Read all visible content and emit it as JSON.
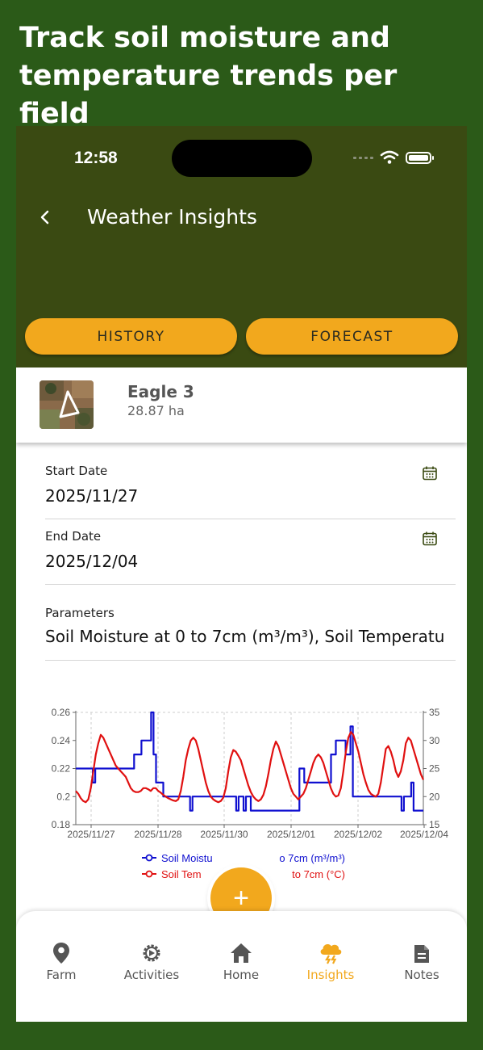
{
  "promo": {
    "line1": "Track soil moisture and",
    "line2": "temperature trends per field"
  },
  "status_bar": {
    "time": "12:58"
  },
  "header": {
    "title": "Weather Insights"
  },
  "tabs": {
    "history": "HISTORY",
    "forecast": "FORECAST"
  },
  "field": {
    "name": "Eagle 3",
    "area": "28.87 ha"
  },
  "form": {
    "start_date": {
      "label": "Start Date",
      "value": "2025/11/27"
    },
    "end_date": {
      "label": "End Date",
      "value": "2025/12/04"
    },
    "parameters": {
      "label": "Parameters",
      "value": "Soil Moisture at 0 to 7cm (m³/m³), Soil Temperatu"
    }
  },
  "chart_data": {
    "type": "line",
    "x_tick_labels": [
      "2025/11/27",
      "2025/11/28",
      "2025/11/30",
      "2025/12/01",
      "2025/12/02",
      "2025/12/04"
    ],
    "y_left_ticks": [
      "0.26",
      "0.24",
      "0.22",
      "0.2",
      "0.18"
    ],
    "y_right_ticks": [
      "35",
      "30",
      "25",
      "20",
      "15"
    ],
    "ylim_left": [
      0.18,
      0.26
    ],
    "ylim_right": [
      15,
      35
    ],
    "grid": "dashed-vertical",
    "legend_position": "bottom",
    "series": [
      {
        "name": "Soil Moisture at 0 to 7cm (m³/m³)",
        "legend_visible": "Soil Moistu",
        "legend_visible_tail": "o 7cm (m³/m³)",
        "axis": "left",
        "color": "#1010d0",
        "values": [
          0.22,
          0.22,
          0.22,
          0.22,
          0.22,
          0.22,
          0.22,
          0.21,
          0.22,
          0.22,
          0.22,
          0.22,
          0.22,
          0.22,
          0.22,
          0.22,
          0.22,
          0.22,
          0.22,
          0.22,
          0.22,
          0.22,
          0.22,
          0.22,
          0.23,
          0.23,
          0.23,
          0.24,
          0.24,
          0.24,
          0.24,
          0.26,
          0.23,
          0.21,
          0.21,
          0.21,
          0.2,
          0.2,
          0.2,
          0.2,
          0.2,
          0.2,
          0.2,
          0.2,
          0.2,
          0.2,
          0.2,
          0.19,
          0.2,
          0.2,
          0.2,
          0.2,
          0.2,
          0.2,
          0.2,
          0.2,
          0.2,
          0.2,
          0.2,
          0.2,
          0.2,
          0.2,
          0.2,
          0.2,
          0.2,
          0.2,
          0.19,
          0.2,
          0.2,
          0.19,
          0.2,
          0.2,
          0.19,
          0.19,
          0.19,
          0.19,
          0.19,
          0.19,
          0.19,
          0.19,
          0.19,
          0.19,
          0.19,
          0.19,
          0.19,
          0.19,
          0.19,
          0.19,
          0.19,
          0.19,
          0.19,
          0.19,
          0.22,
          0.22,
          0.21,
          0.21,
          0.21,
          0.21,
          0.21,
          0.21,
          0.21,
          0.21,
          0.21,
          0.21,
          0.21,
          0.23,
          0.23,
          0.24,
          0.24,
          0.24,
          0.24,
          0.23,
          0.23,
          0.25,
          0.2,
          0.2,
          0.2,
          0.2,
          0.2,
          0.2,
          0.2,
          0.2,
          0.2,
          0.2,
          0.2,
          0.2,
          0.2,
          0.2,
          0.2,
          0.2,
          0.2,
          0.2,
          0.2,
          0.2,
          0.19,
          0.2,
          0.2,
          0.2,
          0.21,
          0.19,
          0.19,
          0.19,
          0.19,
          0.19
        ]
      },
      {
        "name": "Soil Temperature at 0 to 7cm (°C)",
        "legend_visible": "Soil Tem",
        "legend_visible_tail": "to 7cm (°C)",
        "axis": "right",
        "color": "#e01010",
        "values": [
          21.0,
          20.5,
          19.7,
          19.2,
          19.0,
          19.5,
          21.5,
          24.5,
          27.5,
          29.5,
          31.0,
          30.5,
          29.5,
          28.5,
          27.5,
          26.5,
          25.5,
          25.0,
          24.5,
          24.0,
          23.5,
          22.5,
          21.5,
          21.0,
          20.8,
          20.8,
          21.0,
          21.5,
          21.5,
          21.3,
          21.0,
          21.5,
          21.5,
          21.0,
          20.7,
          20.3,
          20.0,
          19.7,
          19.5,
          19.3,
          19.2,
          19.5,
          21.0,
          23.5,
          26.5,
          28.5,
          30.0,
          30.5,
          30.0,
          28.5,
          26.5,
          24.5,
          22.5,
          21.0,
          20.0,
          19.5,
          19.2,
          19.0,
          19.2,
          19.8,
          21.5,
          24.5,
          27.0,
          28.3,
          28.0,
          27.3,
          26.5,
          25.0,
          23.5,
          22.0,
          20.8,
          20.0,
          19.5,
          19.2,
          19.5,
          20.3,
          21.8,
          24.0,
          26.5,
          28.5,
          29.8,
          29.0,
          27.5,
          26.0,
          24.5,
          23.0,
          21.5,
          20.5,
          20.0,
          19.5,
          20.0,
          20.5,
          21.5,
          23.0,
          24.5,
          26.0,
          27.0,
          27.5,
          27.0,
          26.0,
          24.5,
          23.0,
          21.5,
          20.5,
          20.0,
          20.2,
          21.5,
          24.5,
          28.0,
          30.5,
          31.5,
          31.0,
          29.5,
          28.0,
          26.0,
          24.0,
          22.5,
          21.2,
          20.5,
          20.2,
          20.0,
          20.5,
          22.5,
          25.5,
          28.5,
          29.0,
          28.0,
          26.5,
          24.5,
          23.5,
          24.5,
          26.5,
          29.5,
          30.5,
          30.0,
          28.5,
          27.0,
          25.5,
          24.0,
          23.0
        ]
      }
    ]
  },
  "fab": {
    "icon": "+"
  },
  "nav": [
    {
      "label": "Farm",
      "icon": "location-pin-icon"
    },
    {
      "label": "Activities",
      "icon": "gear-icon"
    },
    {
      "label": "Home",
      "icon": "home-icon"
    },
    {
      "label": "Insights",
      "icon": "weather-storm-icon",
      "active": true
    },
    {
      "label": "Notes",
      "icon": "note-icon"
    }
  ],
  "colors": {
    "background": "#2b5a18",
    "appbar": "#3a4a12",
    "accent": "#f2a81d",
    "moisture": "#1010d0",
    "temperature": "#e01010"
  }
}
